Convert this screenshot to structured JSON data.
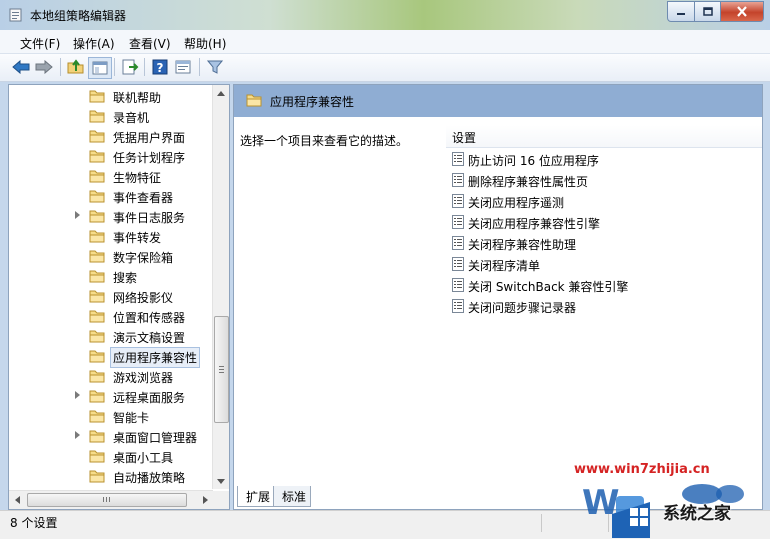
{
  "window": {
    "title": "本地组策略编辑器"
  },
  "menu": {
    "items": [
      {
        "label": "文件(F)"
      },
      {
        "label": "操作(A)"
      },
      {
        "label": "查看(V)"
      },
      {
        "label": "帮助(H)"
      }
    ]
  },
  "toolbar": {
    "buttons": [
      "back-arrow-icon",
      "forward-arrow-icon",
      "up-folder-icon",
      "show-hide-tree-icon",
      "export-list-icon",
      "help-icon",
      "properties-icon",
      "filter-icon"
    ]
  },
  "tree": {
    "items": [
      {
        "label": "联机帮助",
        "expandable": false
      },
      {
        "label": "录音机",
        "expandable": false
      },
      {
        "label": "凭据用户界面",
        "expandable": false
      },
      {
        "label": "任务计划程序",
        "expandable": false
      },
      {
        "label": "生物特征",
        "expandable": false
      },
      {
        "label": "事件查看器",
        "expandable": false
      },
      {
        "label": "事件日志服务",
        "expandable": true
      },
      {
        "label": "事件转发",
        "expandable": false
      },
      {
        "label": "数字保险箱",
        "expandable": false
      },
      {
        "label": "搜索",
        "expandable": false
      },
      {
        "label": "网络投影仪",
        "expandable": false
      },
      {
        "label": "位置和传感器",
        "expandable": false
      },
      {
        "label": "演示文稿设置",
        "expandable": false
      },
      {
        "label": "应用程序兼容性",
        "expandable": false,
        "selected": true
      },
      {
        "label": "游戏浏览器",
        "expandable": false
      },
      {
        "label": "远程桌面服务",
        "expandable": true
      },
      {
        "label": "智能卡",
        "expandable": false
      },
      {
        "label": "桌面窗口管理器",
        "expandable": true
      },
      {
        "label": "桌面小工具",
        "expandable": false
      },
      {
        "label": "自动播放策略",
        "expandable": false
      }
    ],
    "vscroll_position": 0.57
  },
  "content": {
    "header_title": "应用程序兼容性",
    "description": "选择一个项目来查看它的描述。",
    "settings_column": "设置",
    "settings": [
      {
        "label": "防止访问 16 位应用程序"
      },
      {
        "label": "删除程序兼容性属性页"
      },
      {
        "label": "关闭应用程序遥测"
      },
      {
        "label": "关闭应用程序兼容性引擎"
      },
      {
        "label": "关闭程序兼容性助理"
      },
      {
        "label": "关闭程序清单"
      },
      {
        "label": "关闭 SwitchBack 兼容性引擎"
      },
      {
        "label": "关闭问题步骤记录器"
      }
    ]
  },
  "tabs": [
    {
      "label": "扩展",
      "active": true
    },
    {
      "label": "标准",
      "active": false
    }
  ],
  "status": {
    "text": "8 个设置"
  },
  "watermark": {
    "url": "www.win7zhijia.cn",
    "site_name": "系统之家"
  },
  "colors": {
    "header_blue": "#8fadd3",
    "watermark_red": "#d52323"
  }
}
